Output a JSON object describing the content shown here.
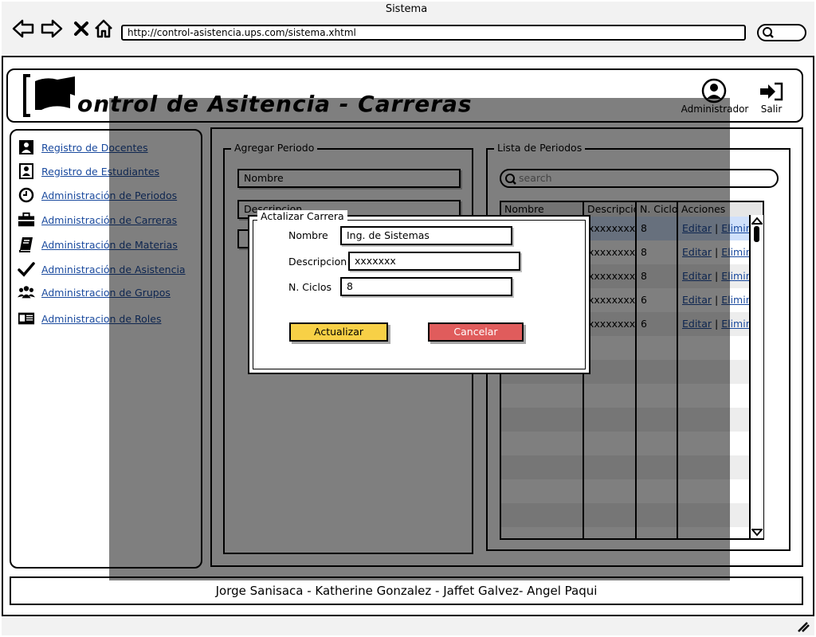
{
  "browser": {
    "title": "Sistema",
    "url": "http://control-asistencia.ups.com/sistema.xhtml"
  },
  "header": {
    "title": "ontrol de Asitencia - Carreras",
    "admin_label": "Administrador",
    "logout_label": "Salir"
  },
  "sidebar": {
    "items": [
      {
        "label": "Registro de Docentes",
        "icon": "teacher-icon"
      },
      {
        "label": "Registro de Estudiantes",
        "icon": "student-icon"
      },
      {
        "label": "Administración de Periodos",
        "icon": "clock-icon"
      },
      {
        "label": "Administración de Carreras",
        "icon": "briefcase-icon"
      },
      {
        "label": "Administración de Materias",
        "icon": "book-icon"
      },
      {
        "label": "Administración de Asistencia",
        "icon": "checkmark-icon"
      },
      {
        "label": "Administracion de Grupos",
        "icon": "group-icon"
      },
      {
        "label": "Administracion de Roles",
        "icon": "id-card-icon"
      }
    ]
  },
  "add_period": {
    "legend": "Agregar Periodo",
    "nombre_placeholder": "Nombre",
    "descripcion_placeholder": "Descripcion"
  },
  "list_period": {
    "legend": "Lista de Periodos",
    "search_placeholder": "search",
    "columns": [
      "Nombre",
      "Descripcio",
      "N. Ciclo",
      "Acciones"
    ],
    "rows": [
      {
        "descripcion": "xxxxxxxx",
        "ciclos": "8",
        "edit": "Editar",
        "sep": "|",
        "delete": "Elimina"
      },
      {
        "descripcion": "xxxxxxxx",
        "ciclos": "8",
        "edit": "Editar",
        "sep": "|",
        "delete": "Elimina"
      },
      {
        "descripcion": "xxxxxxxx",
        "ciclos": "8",
        "edit": "Editar",
        "sep": "|",
        "delete": "Elimina"
      },
      {
        "descripcion": "xxxxxxxx",
        "ciclos": "6",
        "edit": "Editar",
        "sep": "|",
        "delete": "Elimina"
      },
      {
        "descripcion": "xxxxxxxx",
        "ciclos": "6",
        "edit": "Editar",
        "sep": "|",
        "delete": "Elimina"
      }
    ]
  },
  "modal": {
    "legend": "Actalizar Carrera",
    "nombre_label": "Nombre",
    "nombre_value": "Ing. de Sistemas",
    "descripcion_label": "Descripcion",
    "descripcion_value": "xxxxxxx",
    "ciclos_label": "N. Ciclos",
    "ciclos_value": "8",
    "update_button": "Actualizar",
    "cancel_button": "Cancelar"
  },
  "footer": {
    "credits": "Jorge Sanisaca - Katherine Gonzalez - Jaffet Galvez- Angel Paqui"
  },
  "colors": {
    "link": "#1a4a9e",
    "update_button": "#f7d046",
    "cancel_button": "#e05c5c",
    "overlay": "#000000"
  }
}
